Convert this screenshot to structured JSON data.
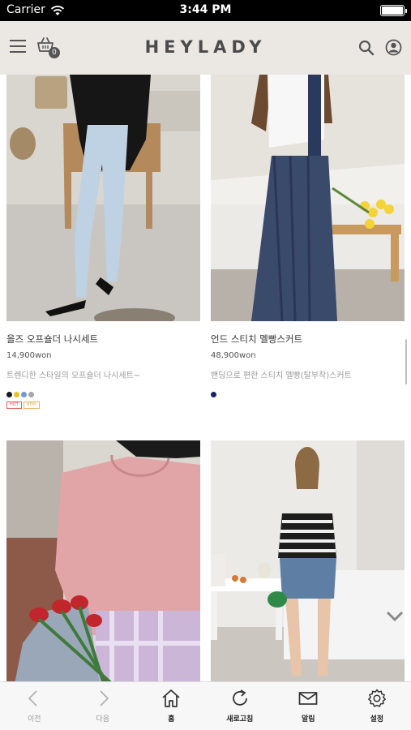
{
  "status_bar": {
    "carrier": "Carrier",
    "time": "3:44 PM",
    "battery_level": 1.0
  },
  "header": {
    "logo": "HEYLADY",
    "cart_count": "0"
  },
  "products": [
    {
      "name": "올즈 오프숄더 나시세트",
      "price": "14,900won",
      "description": "트렌디한 스타일의 오프숄더 나시세트~",
      "colors": [
        "#1a1a1a",
        "#e8c22a",
        "#6f9ad8",
        "#a6a6a6"
      ],
      "badges": [
        {
          "text": "HOT",
          "color": "#e65a5a"
        },
        {
          "text": "NEW",
          "color": "#e0b860"
        }
      ]
    },
    {
      "name": "언드 스티치 멜빵스커트",
      "price": "48,900won",
      "description": "밴딩으로 편한 스티치 멜빵(탈부착)스커트",
      "colors": [
        "#18246a"
      ],
      "badges": []
    }
  ],
  "tabbar": {
    "items": [
      {
        "label": "이전",
        "icon": "chevron-left-icon"
      },
      {
        "label": "다음",
        "icon": "chevron-right-icon"
      },
      {
        "label": "홈",
        "icon": "home-icon"
      },
      {
        "label": "새로고침",
        "icon": "refresh-icon"
      },
      {
        "label": "알림",
        "icon": "mail-icon"
      },
      {
        "label": "설정",
        "icon": "gear-icon"
      }
    ]
  }
}
